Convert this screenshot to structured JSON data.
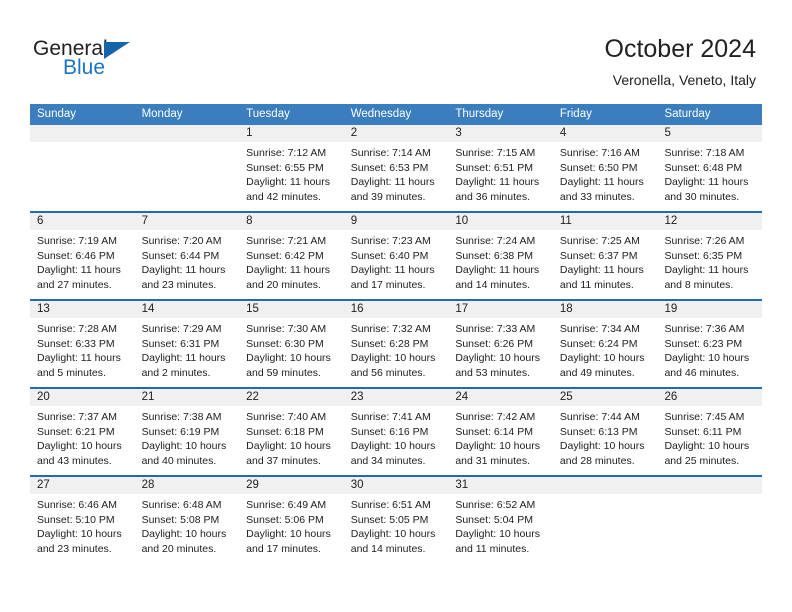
{
  "brand": {
    "line1": "General",
    "line2": "Blue",
    "triangle_color": "#1464aa",
    "blue_color": "#1a76c4"
  },
  "header": {
    "title": "October 2024",
    "subtitle": "Veronella, Veneto, Italy"
  },
  "colors": {
    "header_bar": "#3a7ebf",
    "week_divider": "#1e6bb0",
    "day_band": "#f0f0f0",
    "text": "#212121"
  },
  "weekdays": [
    "Sunday",
    "Monday",
    "Tuesday",
    "Wednesday",
    "Thursday",
    "Friday",
    "Saturday"
  ],
  "weeks": [
    [
      {
        "blank": true
      },
      {
        "blank": true
      },
      {
        "day": "1",
        "sunrise": "Sunrise: 7:12 AM",
        "sunset": "Sunset: 6:55 PM",
        "daylight": "Daylight: 11 hours and 42 minutes."
      },
      {
        "day": "2",
        "sunrise": "Sunrise: 7:14 AM",
        "sunset": "Sunset: 6:53 PM",
        "daylight": "Daylight: 11 hours and 39 minutes."
      },
      {
        "day": "3",
        "sunrise": "Sunrise: 7:15 AM",
        "sunset": "Sunset: 6:51 PM",
        "daylight": "Daylight: 11 hours and 36 minutes."
      },
      {
        "day": "4",
        "sunrise": "Sunrise: 7:16 AM",
        "sunset": "Sunset: 6:50 PM",
        "daylight": "Daylight: 11 hours and 33 minutes."
      },
      {
        "day": "5",
        "sunrise": "Sunrise: 7:18 AM",
        "sunset": "Sunset: 6:48 PM",
        "daylight": "Daylight: 11 hours and 30 minutes."
      }
    ],
    [
      {
        "day": "6",
        "sunrise": "Sunrise: 7:19 AM",
        "sunset": "Sunset: 6:46 PM",
        "daylight": "Daylight: 11 hours and 27 minutes."
      },
      {
        "day": "7",
        "sunrise": "Sunrise: 7:20 AM",
        "sunset": "Sunset: 6:44 PM",
        "daylight": "Daylight: 11 hours and 23 minutes."
      },
      {
        "day": "8",
        "sunrise": "Sunrise: 7:21 AM",
        "sunset": "Sunset: 6:42 PM",
        "daylight": "Daylight: 11 hours and 20 minutes."
      },
      {
        "day": "9",
        "sunrise": "Sunrise: 7:23 AM",
        "sunset": "Sunset: 6:40 PM",
        "daylight": "Daylight: 11 hours and 17 minutes."
      },
      {
        "day": "10",
        "sunrise": "Sunrise: 7:24 AM",
        "sunset": "Sunset: 6:38 PM",
        "daylight": "Daylight: 11 hours and 14 minutes."
      },
      {
        "day": "11",
        "sunrise": "Sunrise: 7:25 AM",
        "sunset": "Sunset: 6:37 PM",
        "daylight": "Daylight: 11 hours and 11 minutes."
      },
      {
        "day": "12",
        "sunrise": "Sunrise: 7:26 AM",
        "sunset": "Sunset: 6:35 PM",
        "daylight": "Daylight: 11 hours and 8 minutes."
      }
    ],
    [
      {
        "day": "13",
        "sunrise": "Sunrise: 7:28 AM",
        "sunset": "Sunset: 6:33 PM",
        "daylight": "Daylight: 11 hours and 5 minutes."
      },
      {
        "day": "14",
        "sunrise": "Sunrise: 7:29 AM",
        "sunset": "Sunset: 6:31 PM",
        "daylight": "Daylight: 11 hours and 2 minutes."
      },
      {
        "day": "15",
        "sunrise": "Sunrise: 7:30 AM",
        "sunset": "Sunset: 6:30 PM",
        "daylight": "Daylight: 10 hours and 59 minutes."
      },
      {
        "day": "16",
        "sunrise": "Sunrise: 7:32 AM",
        "sunset": "Sunset: 6:28 PM",
        "daylight": "Daylight: 10 hours and 56 minutes."
      },
      {
        "day": "17",
        "sunrise": "Sunrise: 7:33 AM",
        "sunset": "Sunset: 6:26 PM",
        "daylight": "Daylight: 10 hours and 53 minutes."
      },
      {
        "day": "18",
        "sunrise": "Sunrise: 7:34 AM",
        "sunset": "Sunset: 6:24 PM",
        "daylight": "Daylight: 10 hours and 49 minutes."
      },
      {
        "day": "19",
        "sunrise": "Sunrise: 7:36 AM",
        "sunset": "Sunset: 6:23 PM",
        "daylight": "Daylight: 10 hours and 46 minutes."
      }
    ],
    [
      {
        "day": "20",
        "sunrise": "Sunrise: 7:37 AM",
        "sunset": "Sunset: 6:21 PM",
        "daylight": "Daylight: 10 hours and 43 minutes."
      },
      {
        "day": "21",
        "sunrise": "Sunrise: 7:38 AM",
        "sunset": "Sunset: 6:19 PM",
        "daylight": "Daylight: 10 hours and 40 minutes."
      },
      {
        "day": "22",
        "sunrise": "Sunrise: 7:40 AM",
        "sunset": "Sunset: 6:18 PM",
        "daylight": "Daylight: 10 hours and 37 minutes."
      },
      {
        "day": "23",
        "sunrise": "Sunrise: 7:41 AM",
        "sunset": "Sunset: 6:16 PM",
        "daylight": "Daylight: 10 hours and 34 minutes."
      },
      {
        "day": "24",
        "sunrise": "Sunrise: 7:42 AM",
        "sunset": "Sunset: 6:14 PM",
        "daylight": "Daylight: 10 hours and 31 minutes."
      },
      {
        "day": "25",
        "sunrise": "Sunrise: 7:44 AM",
        "sunset": "Sunset: 6:13 PM",
        "daylight": "Daylight: 10 hours and 28 minutes."
      },
      {
        "day": "26",
        "sunrise": "Sunrise: 7:45 AM",
        "sunset": "Sunset: 6:11 PM",
        "daylight": "Daylight: 10 hours and 25 minutes."
      }
    ],
    [
      {
        "day": "27",
        "sunrise": "Sunrise: 6:46 AM",
        "sunset": "Sunset: 5:10 PM",
        "daylight": "Daylight: 10 hours and 23 minutes."
      },
      {
        "day": "28",
        "sunrise": "Sunrise: 6:48 AM",
        "sunset": "Sunset: 5:08 PM",
        "daylight": "Daylight: 10 hours and 20 minutes."
      },
      {
        "day": "29",
        "sunrise": "Sunrise: 6:49 AM",
        "sunset": "Sunset: 5:06 PM",
        "daylight": "Daylight: 10 hours and 17 minutes."
      },
      {
        "day": "30",
        "sunrise": "Sunrise: 6:51 AM",
        "sunset": "Sunset: 5:05 PM",
        "daylight": "Daylight: 10 hours and 14 minutes."
      },
      {
        "day": "31",
        "sunrise": "Sunrise: 6:52 AM",
        "sunset": "Sunset: 5:04 PM",
        "daylight": "Daylight: 10 hours and 11 minutes."
      },
      {
        "blank": true
      },
      {
        "blank": true
      }
    ]
  ]
}
